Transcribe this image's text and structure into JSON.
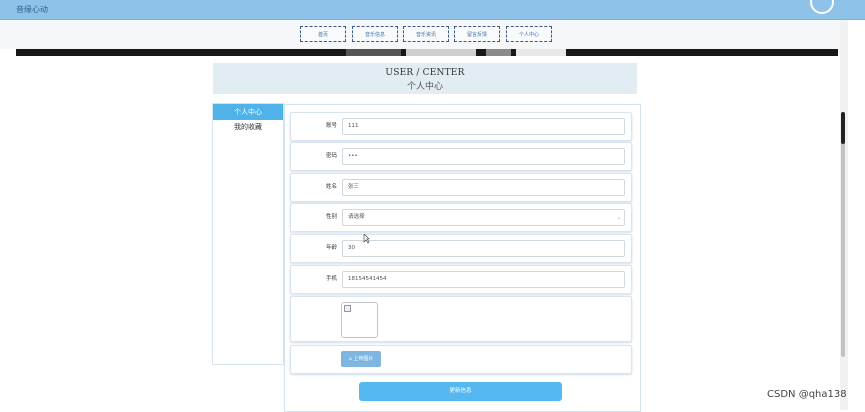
{
  "app": {
    "title": "音缘心动"
  },
  "nav": {
    "items": [
      {
        "label": "首页"
      },
      {
        "label": "音乐信息"
      },
      {
        "label": "音乐资讯"
      },
      {
        "label": "留言反馈"
      },
      {
        "label": "个人中心"
      }
    ]
  },
  "header": {
    "en": "USER / CENTER",
    "zh": "个人中心"
  },
  "sidebar": {
    "items": [
      {
        "label": "个人中心",
        "active": true
      },
      {
        "label": "我的收藏",
        "active": false
      }
    ]
  },
  "form": {
    "account": {
      "label": "账号",
      "value": "111"
    },
    "password": {
      "label": "密码",
      "value": "•••"
    },
    "name": {
      "label": "姓名",
      "value": "张三"
    },
    "gender": {
      "label": "性别",
      "value": "请选择"
    },
    "age": {
      "label": "年龄",
      "value": "30"
    },
    "phone": {
      "label": "手机",
      "value": "18154541454"
    }
  },
  "buttons": {
    "upload": "上传图片",
    "update": "更新信息"
  },
  "watermark": "CSDN @qha138",
  "colors": {
    "accent": "#55b8f0",
    "topbar": "#8fc2e8",
    "header": "#e2edf3"
  }
}
